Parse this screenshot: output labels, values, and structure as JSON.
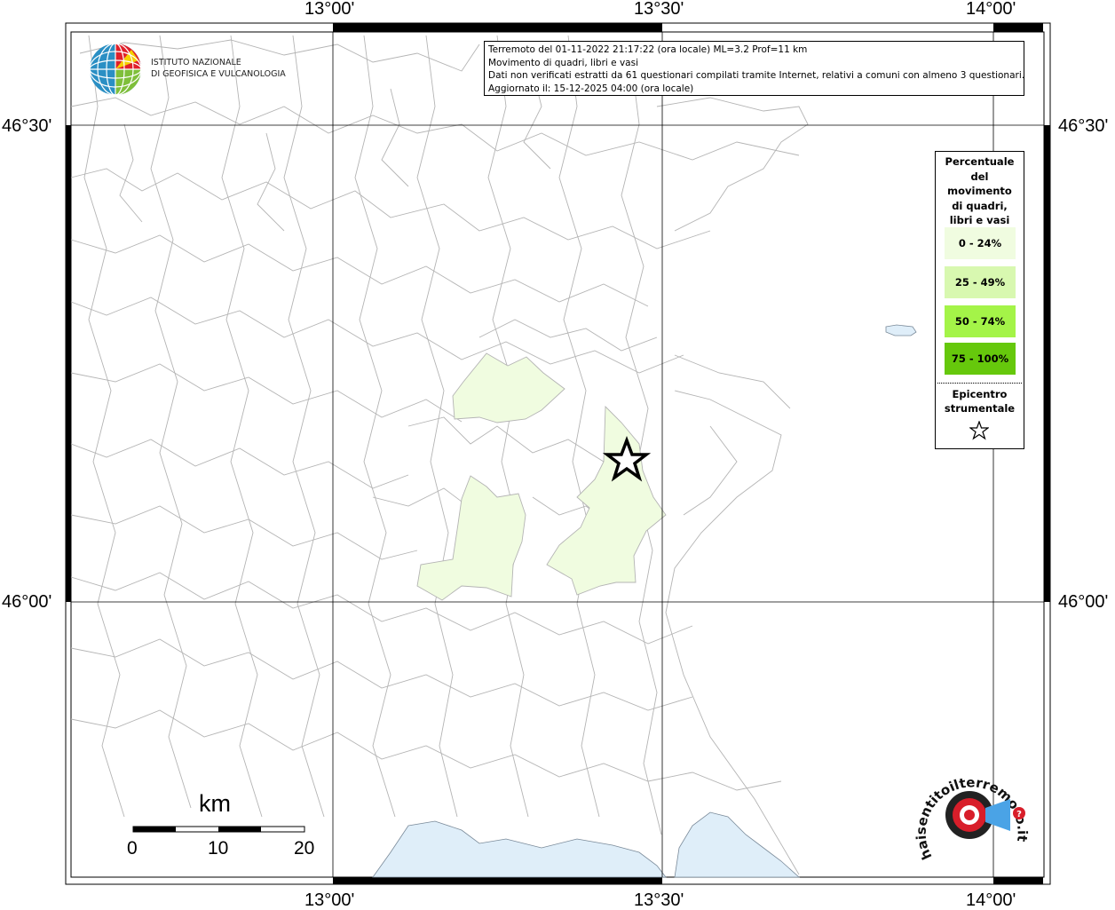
{
  "map": {
    "lon_labels": [
      "13°00'",
      "13°30'",
      "14°00'"
    ],
    "lat_labels": [
      "46°30'",
      "46°00'"
    ]
  },
  "info": {
    "line1": "Terremoto del 01-11-2022 21:17:22 (ora locale) ML=3.2 Prof=11 km",
    "line2": "Movimento di quadri, libri e vasi",
    "line3": "Dati non verificati estratti da 61 questionari compilati tramite Internet, relativi a comuni con almeno 3 questionari.",
    "line4": "Aggiornato il: 15-12-2025 04:00 (ora locale)"
  },
  "legend": {
    "title": "Percentuale\ndel\nmovimento\ndi quadri,\nlibri e vasi",
    "classes": [
      {
        "label": "0 - 24%",
        "color": "#f0fce0"
      },
      {
        "label": "25 - 49%",
        "color": "#d8f8b0"
      },
      {
        "label": "50 - 74%",
        "color": "#a4f448"
      },
      {
        "label": "75 - 100%",
        "color": "#66c80c"
      }
    ],
    "epicenter_label": "Epicentro\nstrumentale",
    "epicenter_icon": "star-icon"
  },
  "ingv_logo": {
    "line1": "ISTITUTO NAZIONALE",
    "line2": "DI GEOFISICA E VULCANOLOGIA"
  },
  "scale": {
    "title": "km",
    "ticks": [
      "0",
      "10",
      "20"
    ]
  },
  "hst_logo": {
    "text": "haisentitoilterremoto.it"
  },
  "colors": {
    "affected_fill": "#f0fce0",
    "sea": "#dfeef9",
    "borders": "#b4b4b4"
  }
}
